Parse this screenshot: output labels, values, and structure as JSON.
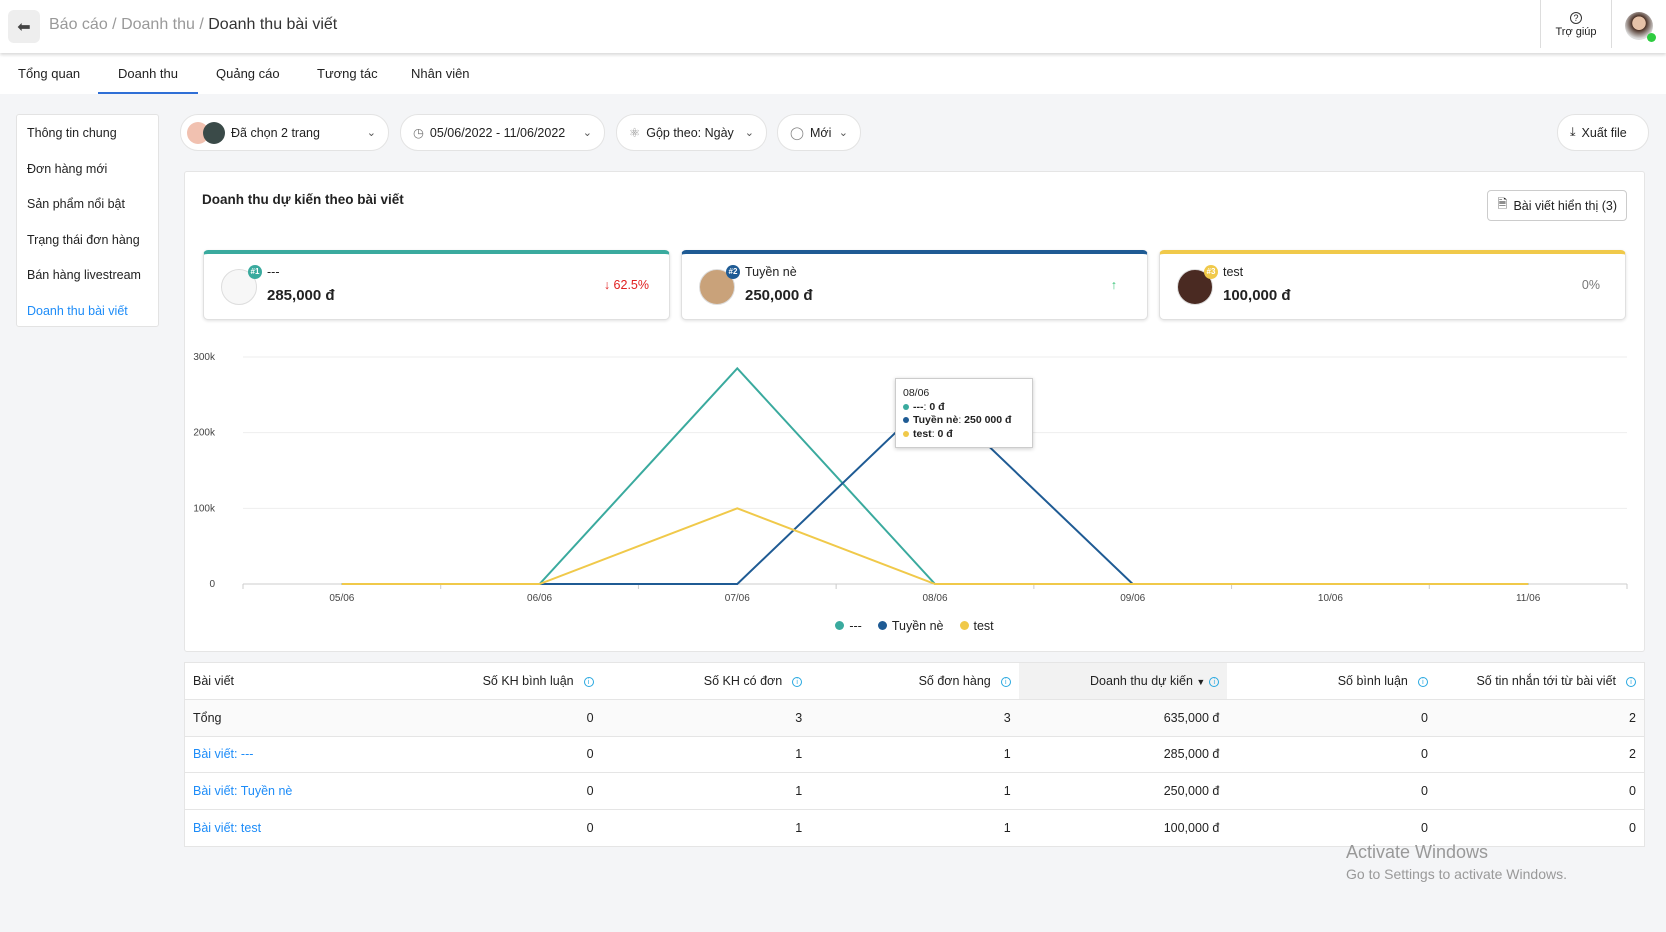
{
  "header": {
    "breadcrumb": [
      "Báo cáo",
      "Doanh thu",
      "Doanh thu bài viết"
    ],
    "help": "Trợ giúp"
  },
  "tabs": [
    "Tổng quan",
    "Doanh thu",
    "Quảng cáo",
    "Tương tác",
    "Nhân viên"
  ],
  "sidebar": [
    "Thông tin chung",
    "Đơn hàng mới",
    "Sản phẩm nổi bật",
    "Trạng thái đơn hàng",
    "Bán hàng livestream",
    "Doanh thu bài viết"
  ],
  "filters": {
    "pages": "Đã chọn 2 trang",
    "date": "05/06/2022 - 11/06/2022",
    "group": "Gộp theo: Ngày",
    "status": "Mới",
    "export": "Xuất file"
  },
  "card": {
    "title": "Doanh thu dự kiến theo bài viết",
    "shown_button": "Bài viết hiển thị (3)"
  },
  "stats": [
    {
      "rank": "#1",
      "name": "---",
      "value": "285,000 đ",
      "change": "62.5%",
      "color": "#3aaa9e"
    },
    {
      "rank": "#2",
      "name": "Tuyền nè",
      "value": "250,000 đ",
      "change": "",
      "color": "#1f5b94"
    },
    {
      "rank": "#3",
      "name": "test",
      "value": "100,000 đ",
      "change": "0%",
      "color": "#f0c94a"
    }
  ],
  "tooltip": {
    "date": "08/06",
    "rows": [
      {
        "name": "---",
        "value": "0 đ"
      },
      {
        "name": "Tuyền nè",
        "value": "250 000 đ"
      },
      {
        "name": "test",
        "value": "0 đ"
      }
    ]
  },
  "chart_data": {
    "type": "line",
    "categories": [
      "05/06",
      "06/06",
      "07/06",
      "08/06",
      "09/06",
      "10/06",
      "11/06"
    ],
    "ylim": [
      0,
      300000
    ],
    "yticks": [
      0,
      100000,
      200000,
      300000
    ],
    "ytick_labels": [
      "0",
      "100k",
      "200k",
      "300k"
    ],
    "legend_position": "bottom",
    "series": [
      {
        "name": "---",
        "color": "#3aaa9e",
        "values": [
          0,
          0,
          285000,
          0,
          0,
          0,
          0
        ]
      },
      {
        "name": "Tuyền nè",
        "color": "#1f5b94",
        "values": [
          0,
          0,
          0,
          250000,
          0,
          0,
          0
        ]
      },
      {
        "name": "test",
        "color": "#f0c94a",
        "values": [
          0,
          0,
          100000,
          0,
          0,
          0,
          0
        ]
      }
    ]
  },
  "table": {
    "headers": [
      "Bài viết",
      "Số KH bình luận",
      "Số KH có đơn",
      "Số đơn hàng",
      "Doanh thu dự kiến",
      "Số bình luận",
      "Số tin nhắn tới từ bài viết"
    ],
    "rows": [
      [
        "Tổng",
        "0",
        "3",
        "3",
        "635,000 đ",
        "0",
        "2"
      ],
      [
        "Bài viết: ---",
        "0",
        "1",
        "1",
        "285,000 đ",
        "0",
        "2"
      ],
      [
        "Bài viết: Tuyền nè",
        "0",
        "1",
        "1",
        "250,000 đ",
        "0",
        "0"
      ],
      [
        "Bài viết: test",
        "0",
        "1",
        "1",
        "100,000 đ",
        "0",
        "0"
      ]
    ]
  },
  "watermark": {
    "title": "Activate Windows",
    "sub": "Go to Settings to activate Windows."
  }
}
